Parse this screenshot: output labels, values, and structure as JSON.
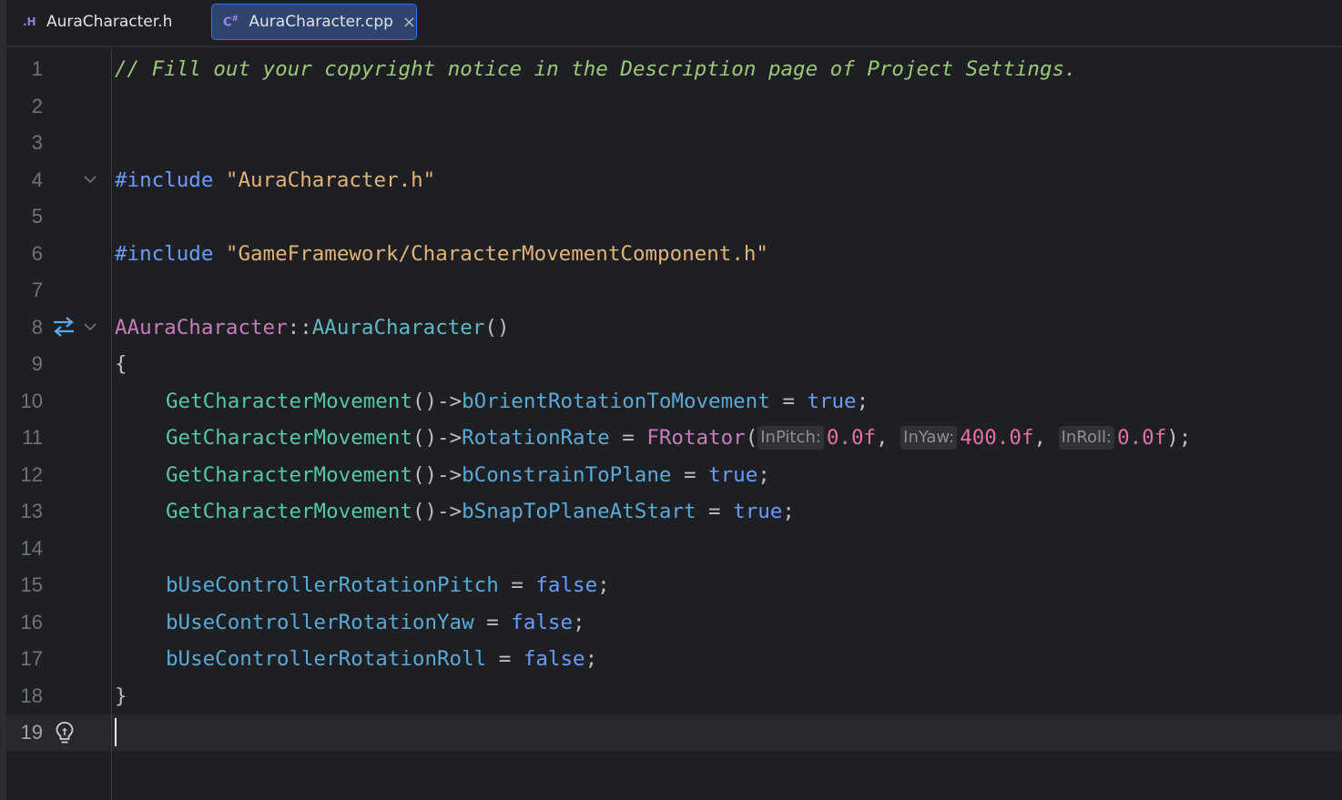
{
  "tabs": [
    {
      "icon": ".H",
      "label": "AuraCharacter.h",
      "active": false
    },
    {
      "icon": "C#",
      "label": "AuraCharacter.cpp",
      "active": true,
      "close": "×"
    }
  ],
  "line_numbers": [
    "1",
    "2",
    "3",
    "4",
    "5",
    "6",
    "7",
    "8",
    "9",
    "10",
    "11",
    "12",
    "13",
    "14",
    "15",
    "16",
    "17",
    "18",
    "19"
  ],
  "current_line": 19,
  "code": {
    "l1_comment": "// Fill out your copyright notice in the Description page of Project Settings.",
    "l4_directive": "#include",
    "l4_string": "\"AuraCharacter.h\"",
    "l6_directive": "#include",
    "l6_string": "\"GameFramework/CharacterMovementComponent.h\"",
    "l8_class": "AAuraCharacter",
    "l8_scope": "::",
    "l8_ctor": "AAuraCharacter",
    "l8_parens": "()",
    "l9_brace": "{",
    "call_name": "GetCharacterMovement",
    "call_suffix": "()->",
    "l10_field": "bOrientRotationToMovement",
    "l11_field": "RotationRate",
    "l11_type": "FRotator",
    "l11_hint_pitch": "InPitch:",
    "l11_val_pitch": "0.0f",
    "l11_hint_yaw": "InYaw:",
    "l11_val_yaw": "400.0f",
    "l11_hint_roll": "InRoll:",
    "l11_val_roll": "0.0f",
    "l12_field": "bConstrainToPlane",
    "l13_field": "bSnapToPlaneAtStart",
    "l15_field": "bUseControllerRotationPitch",
    "l16_field": "bUseControllerRotationYaw",
    "l17_field": "bUseControllerRotationRoll",
    "l18_brace": "}",
    "kw_true": "true",
    "kw_false": "false",
    "assign": " = ",
    "semi": ";",
    "comma": ", ",
    "lparen": "(",
    "rparen": ")"
  },
  "icons": {
    "fold": "chevron-down-icon",
    "implements": "swap-arrows-icon",
    "intention": "lightbulb-icon"
  },
  "colors": {
    "background": "#1e1f22",
    "comment": "#9cc77a",
    "keyword": "#6b9bfa",
    "string": "#e0b37b",
    "number": "#e86ea6",
    "active_tab": "#2e436e"
  }
}
